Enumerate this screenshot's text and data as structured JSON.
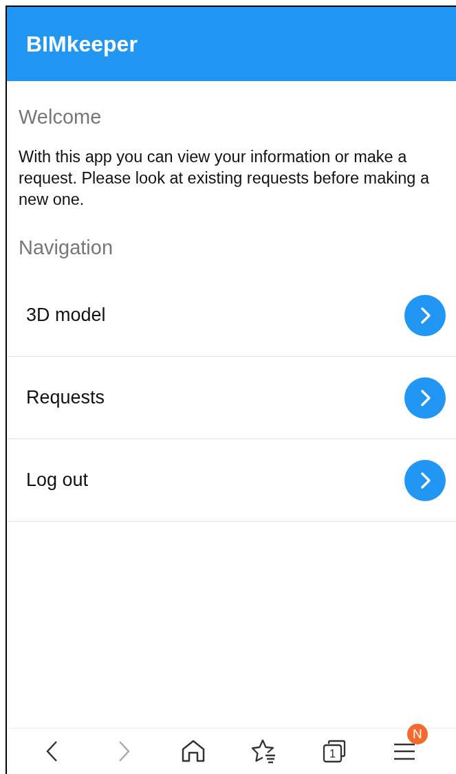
{
  "header": {
    "title": "BIMkeeper"
  },
  "welcome": {
    "heading": "Welcome",
    "text": "With this app you can view your information or make a request. Please look at existing requests before making a new one."
  },
  "navigation": {
    "heading": "Navigation",
    "items": [
      {
        "label": "3D model"
      },
      {
        "label": "Requests"
      },
      {
        "label": "Log out"
      }
    ]
  },
  "browser_toolbar": {
    "buttons": [
      {
        "kind": "back",
        "disabled": false
      },
      {
        "kind": "forward",
        "disabled": true
      },
      {
        "kind": "home",
        "disabled": false
      },
      {
        "kind": "bookmarks",
        "disabled": false
      },
      {
        "kind": "tabs",
        "disabled": false,
        "count": "1"
      },
      {
        "kind": "menu",
        "disabled": false,
        "badge": "N"
      }
    ]
  }
}
